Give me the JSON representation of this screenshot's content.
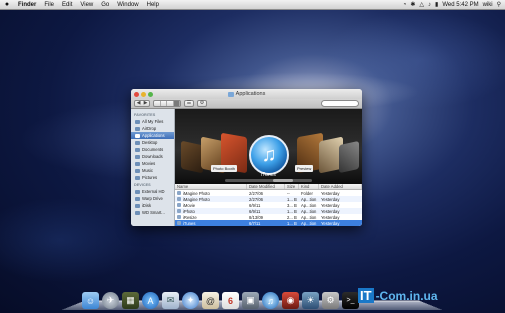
{
  "menubar": {
    "apple": "",
    "items": [
      "Finder",
      "File",
      "Edit",
      "View",
      "Go",
      "Window",
      "Help"
    ],
    "clock": "Wed 5:42 PM",
    "user": "wiki"
  },
  "window": {
    "title": "Applications",
    "search_placeholder": "",
    "sidebar": {
      "favorites_header": "FAVORITES",
      "favorites": [
        "All My Files",
        "AirDrop",
        "Applications",
        "Desktop",
        "Documents",
        "Downloads",
        "Movies",
        "Music",
        "Pictures"
      ],
      "devices_header": "DEVICES",
      "devices": [
        "External HD",
        "Warp Drive",
        "iDisk",
        "WD Smart..."
      ]
    },
    "coverflow": {
      "caption": "iTunes",
      "tag_left": "Photo Booth",
      "tag_right": "Preview"
    },
    "columns": [
      "Name",
      "Date Modified",
      "Size",
      "Kind",
      "Date Added"
    ],
    "rows": [
      {
        "name": "iMagine Photo",
        "date": "2/27/06",
        "size": "--",
        "kind": "Folder",
        "added": "Yesterday"
      },
      {
        "name": "iMagine Photo",
        "date": "2/27/06",
        "size": "1... B",
        "kind": "Ap...tion",
        "added": "Yesterday"
      },
      {
        "name": "iMovie",
        "date": "6/9/11",
        "size": "3... B",
        "kind": "Ap...tion",
        "added": "Yesterday"
      },
      {
        "name": "iPhoto",
        "date": "6/9/11",
        "size": "1... B",
        "kind": "Ap...tion",
        "added": "Yesterday"
      },
      {
        "name": "iResize",
        "date": "8/13/09",
        "size": "2... B",
        "kind": "Ap...tion",
        "added": "Yesterday"
      },
      {
        "name": "iTunes",
        "date": "6/7/11",
        "size": "1... B",
        "kind": "Ap...tion",
        "added": "Yesterday"
      }
    ],
    "selected_row": 5
  },
  "dock": {
    "calendar_day": "6",
    "icons": [
      "finder-icon",
      "launchpad-icon",
      "mission-control-icon",
      "app-store-icon",
      "mail-icon",
      "safari-icon",
      "ical-icon",
      "itunes-icon",
      "photo-booth-icon",
      "iphoto-icon",
      "system-preferences-icon",
      "terminal-icon",
      "trash-icon"
    ]
  },
  "watermark": {
    "box": "IT",
    "text": "-Com.in.ua"
  }
}
